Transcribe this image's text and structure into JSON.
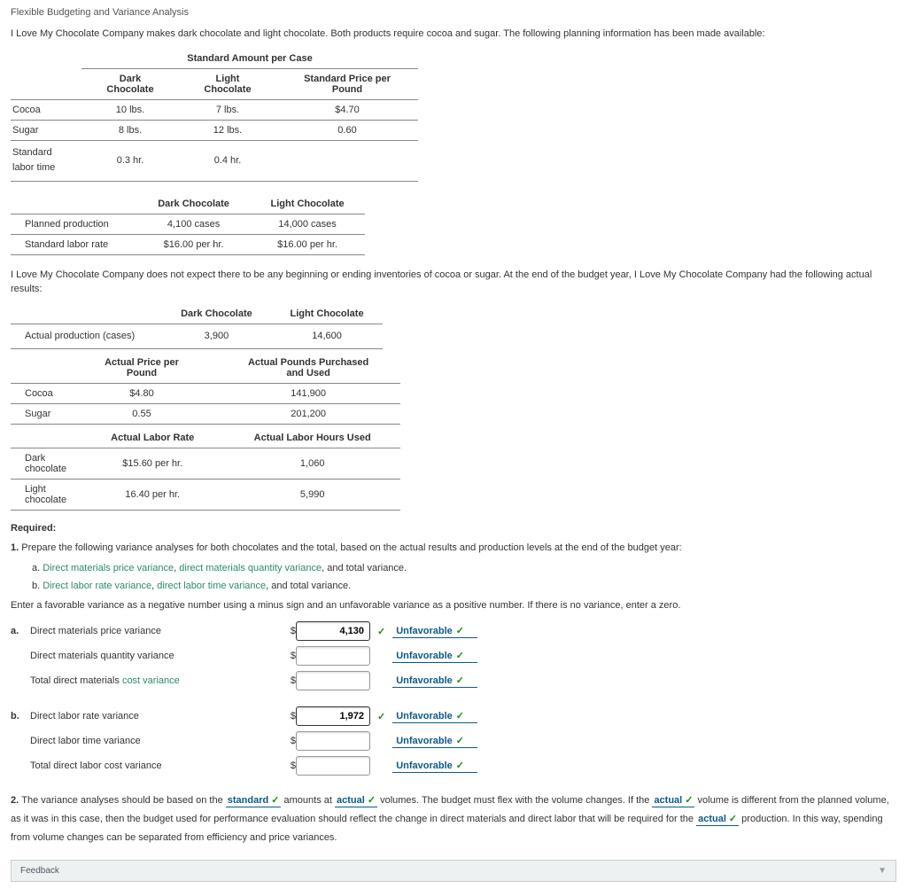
{
  "title": "Flexible Budgeting and Variance Analysis",
  "intro": "I Love My Chocolate Company makes dark chocolate and light chocolate. Both products require cocoa and sugar. The following planning information has been made available:",
  "table1": {
    "caption": "Standard Amount per Case",
    "cols": [
      "Dark Chocolate",
      "Light Chocolate",
      "Standard Price per Pound"
    ],
    "rows": [
      {
        "label": "Cocoa",
        "dark": "10 lbs.",
        "light": "7 lbs.",
        "price": "$4.70"
      },
      {
        "label": "Sugar",
        "dark": "8 lbs.",
        "light": "12 lbs.",
        "price": "0.60"
      },
      {
        "label": "Standard labor time",
        "dark": "0.3 hr.",
        "light": "0.4 hr.",
        "price": ""
      }
    ]
  },
  "table2": {
    "cols": [
      "Dark Chocolate",
      "Light Chocolate"
    ],
    "rows": [
      {
        "label": "Planned production",
        "c1": "4,100 cases",
        "c2": "14,000 cases"
      },
      {
        "label": "Standard labor rate",
        "c1": "$16.00 per hr.",
        "c2": "$16.00 per hr."
      }
    ]
  },
  "midtext": "I Love My Chocolate Company does not expect there to be any beginning or ending inventories of cocoa or sugar. At the end of the budget year, I Love My Chocolate Company had the following actual results:",
  "table3": {
    "cols": [
      "Dark Chocolate",
      "Light Chocolate"
    ],
    "rows": [
      {
        "label": "Actual production (cases)",
        "c1": "3,900",
        "c2": "14,600"
      }
    ]
  },
  "table4": {
    "cols": [
      "Actual Price per Pound",
      "Actual Pounds Purchased and Used"
    ],
    "rows": [
      {
        "label": "Cocoa",
        "c1": "$4.80",
        "c2": "141,900"
      },
      {
        "label": "Sugar",
        "c1": "0.55",
        "c2": "201,200"
      }
    ]
  },
  "table5": {
    "cols": [
      "Actual Labor Rate",
      "Actual Labor Hours Used"
    ],
    "rows": [
      {
        "label": "Dark chocolate",
        "c1": "$15.60 per hr.",
        "c2": "1,060"
      },
      {
        "label": "Light chocolate",
        "c1": "16.40 per hr.",
        "c2": "5,990"
      }
    ]
  },
  "required_label": "Required:",
  "q1": "Prepare the following variance analyses for both chocolates and the total, based on the actual results and production levels at the end of the budget year:",
  "q1a_parts": {
    "pre": "a. ",
    "l1": "Direct materials price variance",
    "sep1": ", ",
    "l2": "direct materials quantity variance",
    "post": ", and total variance."
  },
  "q1b_parts": {
    "pre": "b. ",
    "l1": "Direct labor rate variance",
    "sep1": ", ",
    "l2": "direct labor time variance",
    "post": ", and total variance."
  },
  "instr": "Enter a favorable variance as a negative number using a minus sign and an unfavorable variance as a positive number. If there is no variance, enter a zero.",
  "answers": {
    "a": [
      {
        "label": "Direct materials price variance",
        "value": "4,130",
        "filled": true,
        "drop": "Unfavorable"
      },
      {
        "label": "Direct materials quantity variance",
        "value": "",
        "filled": false,
        "drop": "Unfavorable"
      },
      {
        "label": "Total direct materials ",
        "linktext": "cost variance",
        "value": "",
        "filled": false,
        "drop": "Unfavorable"
      }
    ],
    "b": [
      {
        "label": "Direct labor rate variance",
        "value": "1,972",
        "filled": true,
        "drop": "Unfavorable"
      },
      {
        "label": "Direct labor time variance",
        "value": "",
        "filled": false,
        "drop": "Unfavorable"
      },
      {
        "label": "Total direct labor cost variance",
        "value": "",
        "filled": false,
        "drop": "Unfavorable"
      }
    ]
  },
  "q2": {
    "p1": "The variance analyses should be based on the ",
    "d1": "standard",
    "p2": " amounts at ",
    "d2": "actual",
    "p3": " volumes. The budget must flex with the volume changes. If the ",
    "d3": "actual",
    "p4": " volume is different from the planned volume, as it was in this case, then the budget used for performance evaluation should reflect the change in direct materials and direct labor that will be required for the ",
    "d4": "actual",
    "p5": " production. In this way, spending from volume changes can be separated from efficiency and price variances."
  },
  "feedback_label": "Feedback",
  "check_glyph": "✓",
  "chev_glyph": "✓",
  "tri_glyph": "▼"
}
